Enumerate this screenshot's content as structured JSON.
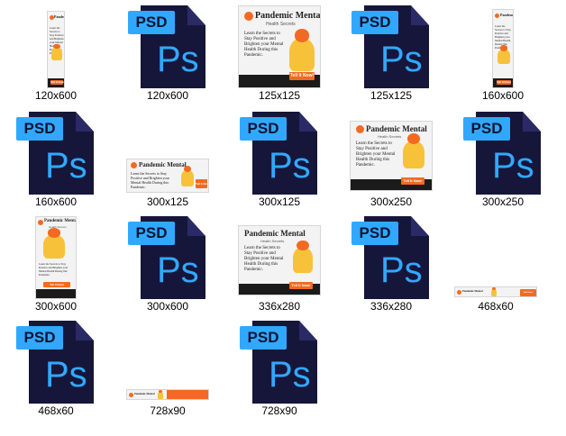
{
  "files": [
    {
      "label": "120x600",
      "kind": "banner"
    },
    {
      "label": "120x600",
      "kind": "psd"
    },
    {
      "label": "125x125",
      "kind": "banner"
    },
    {
      "label": "125x125",
      "kind": "psd"
    },
    {
      "label": "160x600",
      "kind": "banner"
    },
    {
      "label": "160x600",
      "kind": "psd"
    },
    {
      "label": "300x125",
      "kind": "banner"
    },
    {
      "label": "300x125",
      "kind": "psd"
    },
    {
      "label": "300x250",
      "kind": "banner"
    },
    {
      "label": "300x250",
      "kind": "psd"
    },
    {
      "label": "300x600",
      "kind": "banner"
    },
    {
      "label": "300x600",
      "kind": "psd"
    },
    {
      "label": "336x280",
      "kind": "banner"
    },
    {
      "label": "336x280",
      "kind": "psd"
    },
    {
      "label": "468x60",
      "kind": "banner"
    },
    {
      "label": "468x60",
      "kind": "psd"
    },
    {
      "label": "728x90",
      "kind": "banner"
    },
    {
      "label": "728x90",
      "kind": "psd"
    }
  ],
  "psd_icon": {
    "tag": "PSD",
    "glyph": "Ps"
  },
  "banner": {
    "brand": "Pandemic Mental",
    "subbrand": "Health Secrets",
    "headline": "Learn the Secrets to Stay Positive and Brighten your Mental Health During this Pandemic.",
    "cta": "Tell It Now!"
  },
  "colors": {
    "psd_tag": "#31a8ff",
    "psd_body": "#16163a",
    "brand_orange": "#f26a21",
    "figure_yellow": "#f7c23a",
    "band_dark": "#1b1b1b"
  }
}
